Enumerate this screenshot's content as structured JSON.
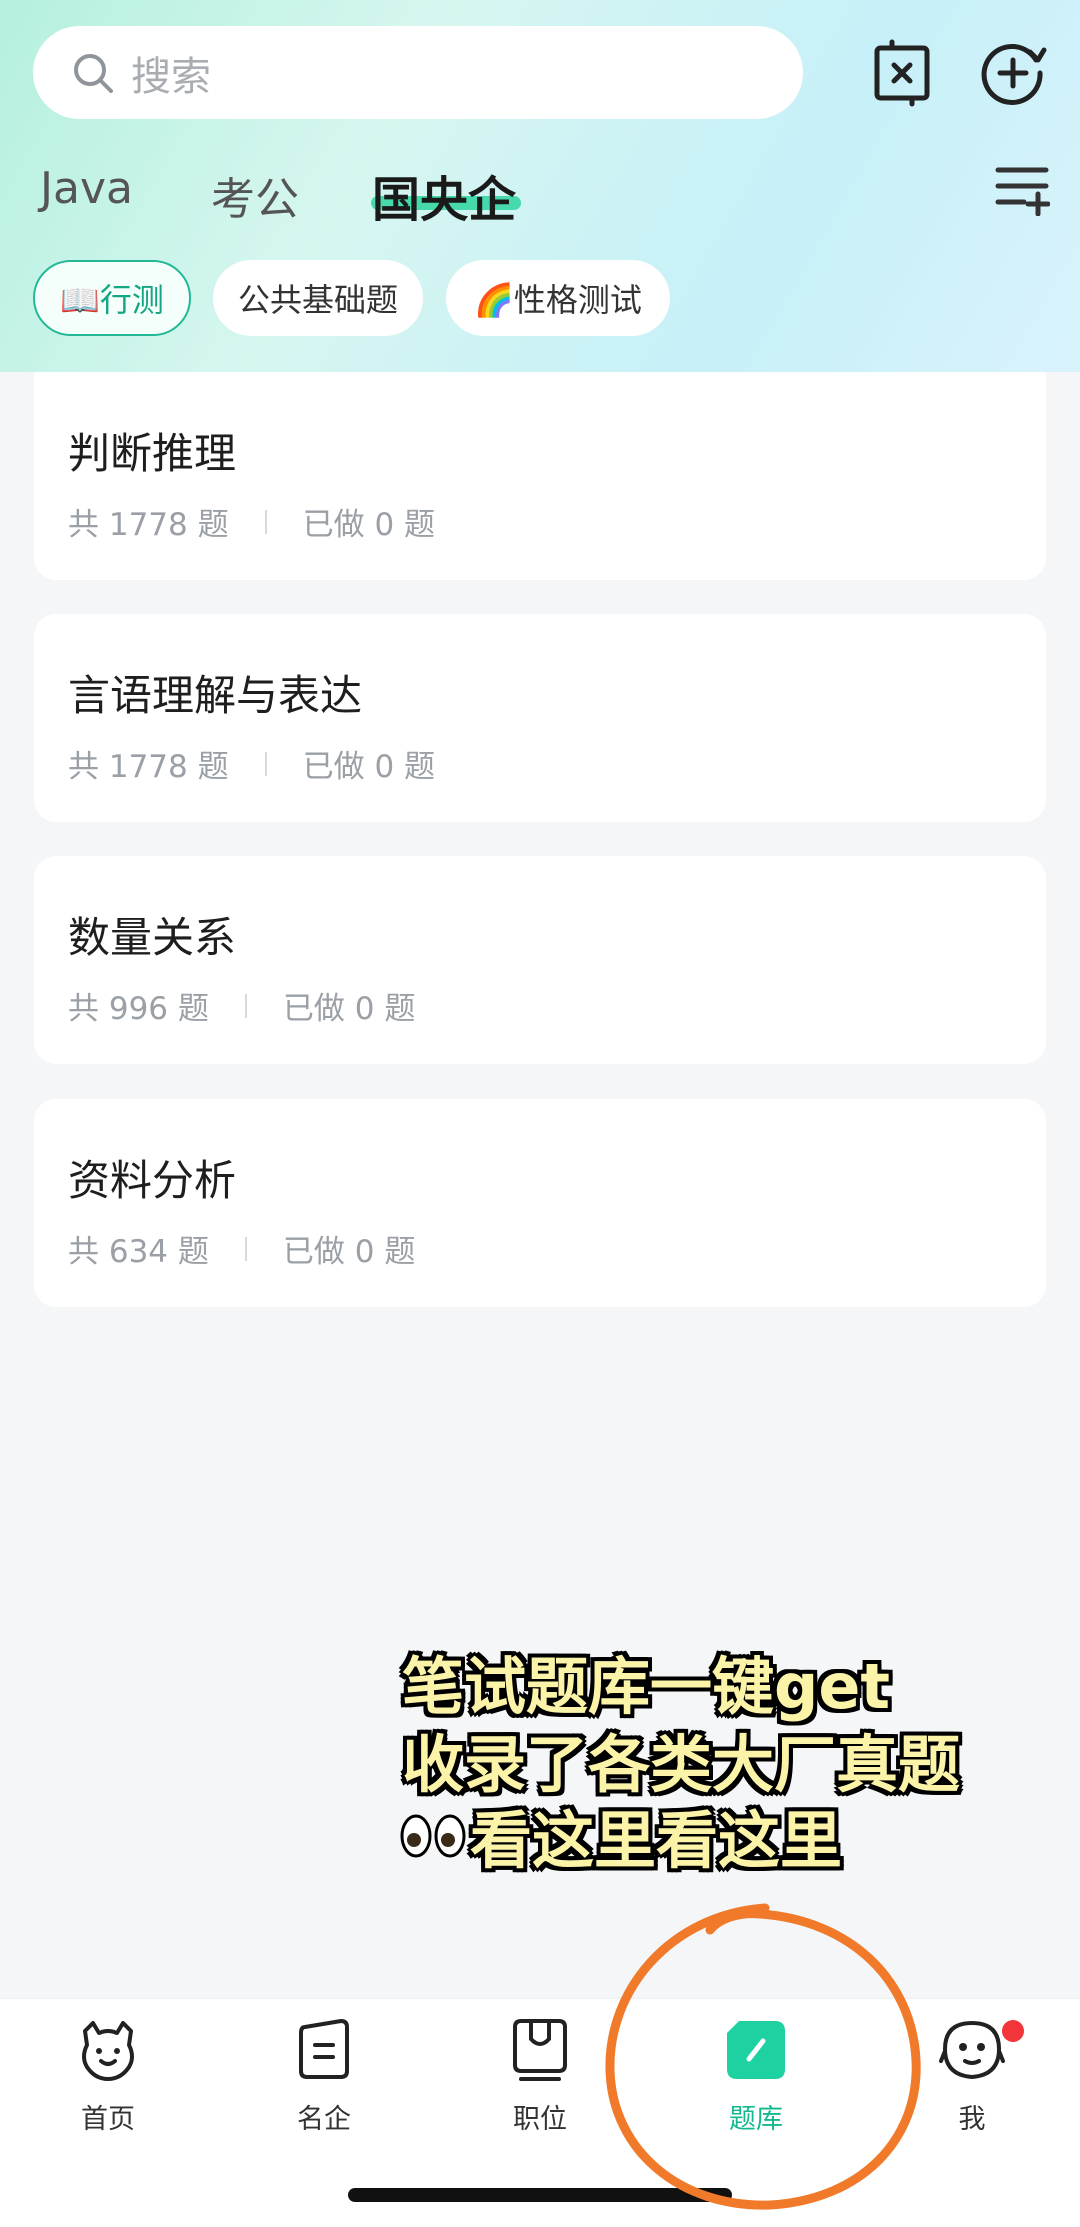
{
  "search": {
    "placeholder": "搜索"
  },
  "category_tabs": [
    {
      "label": "Java"
    },
    {
      "label": "考公"
    },
    {
      "label": "国央企",
      "active": true
    }
  ],
  "sub_chips": [
    {
      "label": "📖行测",
      "active": true
    },
    {
      "label": "公共基础题"
    },
    {
      "label": "🌈性格测试"
    }
  ],
  "question_banks": [
    {
      "title": "判断推理",
      "total": "共 1778 题",
      "done": "已做 0 题"
    },
    {
      "title": "言语理解与表达",
      "total": "共 1778 题",
      "done": "已做 0 题"
    },
    {
      "title": "数量关系",
      "total": "共 996 题",
      "done": "已做 0 题"
    },
    {
      "title": "资料分析",
      "total": "共 634 题",
      "done": "已做 0 题"
    }
  ],
  "overlay": {
    "line1": "笔试题库一键get",
    "line2": "收录了各类大厂真题",
    "line3": "看这里看这里"
  },
  "bottom_nav": [
    {
      "label": "首页",
      "icon": "home-icon"
    },
    {
      "label": "名企",
      "icon": "company-icon"
    },
    {
      "label": "职位",
      "icon": "job-icon"
    },
    {
      "label": "题库",
      "icon": "question-bank-icon",
      "active": true
    },
    {
      "label": "我",
      "icon": "profile-icon"
    }
  ],
  "colors": {
    "accent": "#16b98f",
    "overlay_text": "#fbf3a8",
    "annotation_circle": "#f07a2a",
    "notification_dot": "#f2353a"
  }
}
